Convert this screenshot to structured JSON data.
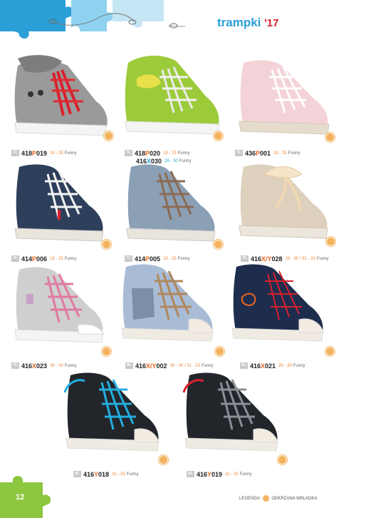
{
  "header": {
    "title": "trampki",
    "year": "'17"
  },
  "products": [
    {
      "num": "73.",
      "code_pre": "418",
      "code_hl": "P",
      "code_post": "019",
      "size": "18 - 25",
      "brand": "Funny"
    },
    {
      "num": "74.",
      "code_pre": "418",
      "code_hl": "P",
      "code_post": "020",
      "size": "18 - 25",
      "brand": "Funny",
      "code2_pre": "416",
      "code2_hl": "X",
      "code2_post": "030",
      "size2": "26 - 30",
      "brand2": "Funny"
    },
    {
      "num": "75.",
      "code_pre": "436",
      "code_hl": "P",
      "code_post": "001",
      "size": "18 - 25",
      "brand": "Funny"
    },
    {
      "num": "76.",
      "code_pre": "414",
      "code_hl": "P",
      "code_post": "006",
      "size": "18 - 25",
      "brand": "Funny"
    },
    {
      "num": "77.",
      "code_pre": "414",
      "code_hl": "P",
      "code_post": "005",
      "size": "18 - 25",
      "brand": "Funny"
    },
    {
      "num": "78.",
      "code_pre": "416",
      "code_hl": "X/Y",
      "code_post": "028",
      "size": "26 - 30 / 31 - 33",
      "brand": "Funny"
    },
    {
      "num": "79.",
      "code_pre": "416",
      "code_hl": "X",
      "code_post": "023",
      "size": "26 - 30",
      "brand": "Funny"
    },
    {
      "num": "80.",
      "code_pre": "416",
      "code_hl": "X/Y",
      "code_post": "002",
      "size": "26 - 30 / 31 - 33",
      "brand": "Funny"
    },
    {
      "num": "81.",
      "code_pre": "416",
      "code_hl": "X",
      "code_post": "021",
      "size": "26 - 30",
      "brand": "Funny"
    },
    {
      "num": "82.",
      "code_pre": "416",
      "code_hl": "Y",
      "code_post": "018",
      "size": "31 - 33",
      "brand": "Funny"
    },
    {
      "num": "83.",
      "code_pre": "416",
      "code_hl": "Y",
      "code_post": "019",
      "size": "31 - 33",
      "brand": "Funny"
    }
  ],
  "footer": {
    "page": "12",
    "legend_label": "LEGENDA:",
    "legend_text": "ODKRZANA WKŁADKA"
  },
  "colors": {
    "accent_blue": "#2a9fd8",
    "accent_green": "#8dc63f",
    "accent_orange": "#e8661f",
    "year_red": "#d9202c"
  }
}
